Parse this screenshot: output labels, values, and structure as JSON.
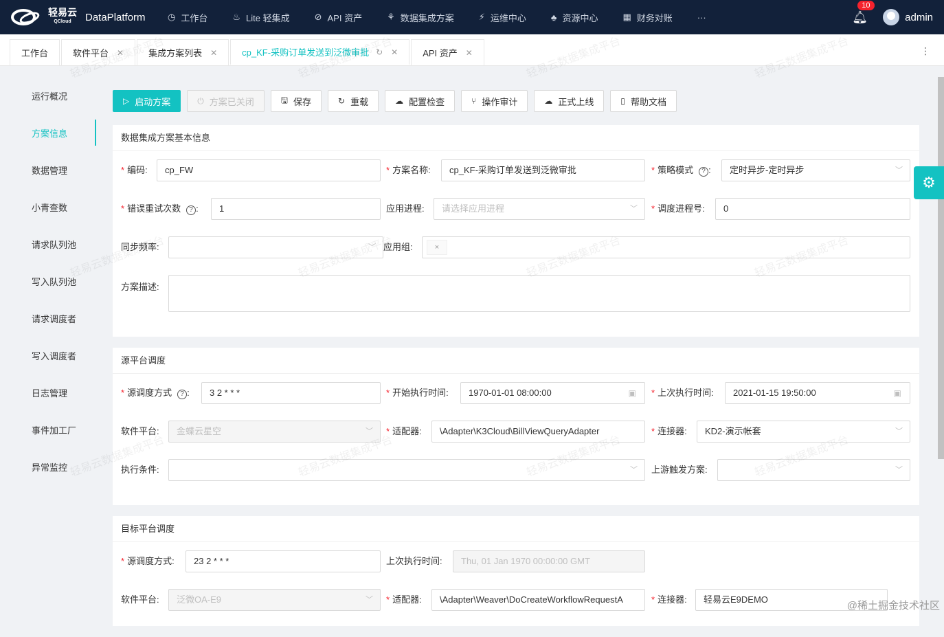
{
  "app": {
    "logo_cn": "轻易云",
    "logo_en": "QCloud",
    "title": "DataPlatform"
  },
  "nav": [
    {
      "icon": "clock-icon",
      "glyph": "◷",
      "label": "工作台"
    },
    {
      "icon": "bulb-icon",
      "glyph": "♨",
      "label": "Lite 轻集成"
    },
    {
      "icon": "compass-icon",
      "glyph": "⊘",
      "label": "API 资产"
    },
    {
      "icon": "nodes-icon",
      "glyph": "⚘",
      "label": "数据集成方案"
    },
    {
      "icon": "flash-icon",
      "glyph": "⚡",
      "label": "运维中心"
    },
    {
      "icon": "cluster-icon",
      "glyph": "♣",
      "label": "资源中心"
    },
    {
      "icon": "calculator-icon",
      "glyph": "▦",
      "label": "财务对账"
    },
    {
      "icon": "more-icon",
      "glyph": "···",
      "label": ""
    }
  ],
  "user": {
    "notifications": "10",
    "name": "admin"
  },
  "tabs": [
    {
      "label": "工作台",
      "closable": false
    },
    {
      "label": "软件平台",
      "closable": true
    },
    {
      "label": "集成方案列表",
      "closable": true
    },
    {
      "label": "cp_KF-采购订单发送到泛微审批",
      "closable": true,
      "active": true
    },
    {
      "label": "API 资产",
      "closable": true
    }
  ],
  "sidebar": [
    "运行概况",
    "方案信息",
    "数据管理",
    "小青查数",
    "请求队列池",
    "写入队列池",
    "请求调度者",
    "写入调度者",
    "日志管理",
    "事件加工厂",
    "异常监控"
  ],
  "toolbar": {
    "start": "启动方案",
    "closed": "方案已关闭",
    "save": "保存",
    "reload": "重载",
    "check": "配置检查",
    "audit": "操作审计",
    "online": "正式上线",
    "help": "帮助文档"
  },
  "basic": {
    "title": "数据集成方案基本信息",
    "code_label": "编码:",
    "code": "cp_FW",
    "name_label": "方案名称:",
    "name": "cp_KF-采购订单发送到泛微审批",
    "strategy_label": "策略模式",
    "strategy": "定时异步-定时异步",
    "retry_label": "错误重试次数",
    "retry": "1",
    "process_label": "应用进程:",
    "process_ph": "请选择应用进程",
    "sched_label": "调度进程号:",
    "sched": "0",
    "freq_label": "同步频率:",
    "group_label": "应用组:",
    "group_tag": "×",
    "desc_label": "方案描述:"
  },
  "source": {
    "title": "源平台调度",
    "mode_label": "源调度方式",
    "mode": "3 2 * * *",
    "start_label": "开始执行时间:",
    "start": "1970-01-01 08:00:00",
    "last_label": "上次执行时间:",
    "last": "2021-01-15 19:50:00",
    "platform_label": "软件平台:",
    "platform": "金蝶云星空",
    "adapter_label": "适配器:",
    "adapter": "\\Adapter\\K3Cloud\\BillViewQueryAdapter",
    "connector_label": "连接器:",
    "connector": "KD2-演示帐套",
    "cond_label": "执行条件:",
    "upstream_label": "上游触发方案:"
  },
  "target": {
    "title": "目标平台调度",
    "mode_label": "源调度方式:",
    "mode": "23 2 * * *",
    "last_label": "上次执行时间:",
    "last": "Thu, 01 Jan 1970 00:00:00 GMT",
    "platform_label": "软件平台:",
    "platform": "泛微OA-E9",
    "adapter_label": "适配器:",
    "adapter": "\\Adapter\\Weaver\\DoCreateWorkflowRequestA",
    "connector_label": "连接器:",
    "connector": "轻易云E9DEMO"
  },
  "watermark": "轻易云数据集成平台",
  "footer": "@稀土掘金技术社区"
}
